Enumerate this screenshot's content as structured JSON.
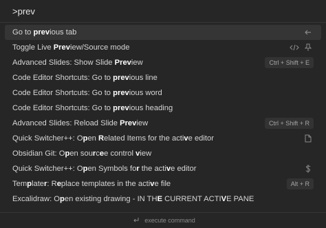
{
  "query": {
    "value": ">prev",
    "placeholder": ""
  },
  "items": [
    {
      "parts": [
        [
          "Go to ",
          false
        ],
        [
          "prev",
          true
        ],
        [
          "ious tab",
          false
        ]
      ]
    },
    {
      "parts": [
        [
          "Toggle Live ",
          false
        ],
        [
          "Prev",
          true
        ],
        [
          "iew/Source mode",
          false
        ]
      ]
    },
    {
      "parts": [
        [
          "Advanced Slides: Show Slide ",
          false
        ],
        [
          "Prev",
          true
        ],
        [
          "iew",
          false
        ]
      ],
      "hotkey": "Ctrl + Shift + E"
    },
    {
      "parts": [
        [
          "Code Editor Shortcuts: Go to ",
          false
        ],
        [
          "prev",
          true
        ],
        [
          "ious line",
          false
        ]
      ]
    },
    {
      "parts": [
        [
          "Code Editor Shortcuts: Go to ",
          false
        ],
        [
          "prev",
          true
        ],
        [
          "ious word",
          false
        ]
      ]
    },
    {
      "parts": [
        [
          "Code Editor Shortcuts: Go to ",
          false
        ],
        [
          "prev",
          true
        ],
        [
          "ious heading",
          false
        ]
      ]
    },
    {
      "parts": [
        [
          "Advanced Slides: Reload Slide ",
          false
        ],
        [
          "Prev",
          true
        ],
        [
          "iew",
          false
        ]
      ],
      "hotkey": "Ctrl + Shift + R"
    },
    {
      "parts": [
        [
          "Quick Switcher++: O",
          false
        ],
        [
          "p",
          true
        ],
        [
          "en ",
          false
        ],
        [
          "R",
          true
        ],
        [
          "elated Items for the acti",
          false
        ],
        [
          "v",
          true
        ],
        [
          "e editor",
          false
        ]
      ]
    },
    {
      "parts": [
        [
          "Obsidian Git: O",
          false
        ],
        [
          "p",
          true
        ],
        [
          "en sou",
          false
        ],
        [
          "r",
          true
        ],
        [
          "c",
          false
        ],
        [
          "e",
          true
        ],
        [
          "e control ",
          false
        ],
        [
          "v",
          true
        ],
        [
          "iew",
          false
        ]
      ]
    },
    {
      "parts": [
        [
          "Quick Switcher++: O",
          false
        ],
        [
          "p",
          true
        ],
        [
          "en Symbols fo",
          false
        ],
        [
          "r",
          true
        ],
        [
          " the acti",
          false
        ],
        [
          "v",
          true
        ],
        [
          "e editor",
          false
        ]
      ]
    },
    {
      "parts": [
        [
          "Tem",
          false
        ],
        [
          "p",
          true
        ],
        [
          "late",
          false
        ],
        [
          "r",
          true
        ],
        [
          ": R",
          false
        ],
        [
          "e",
          true
        ],
        [
          "place templates in the acti",
          false
        ],
        [
          "v",
          true
        ],
        [
          "e file",
          false
        ]
      ],
      "hotkey": "Alt + R"
    },
    {
      "parts": [
        [
          "Excalidraw: O",
          false
        ],
        [
          "p",
          true
        ],
        [
          "en existing drawing - IN TH",
          false
        ],
        [
          "E",
          true
        ],
        [
          " CURRENT ACTI",
          false
        ],
        [
          "V",
          true
        ],
        [
          "E PANE",
          false
        ]
      ]
    }
  ],
  "icons": {
    "item0": "arrow-left-icon",
    "item1": "code-icon",
    "item7": "file-icon",
    "item9": "dollar-icon"
  },
  "footer": {
    "label": "execute command",
    "icon": "enter-icon"
  }
}
